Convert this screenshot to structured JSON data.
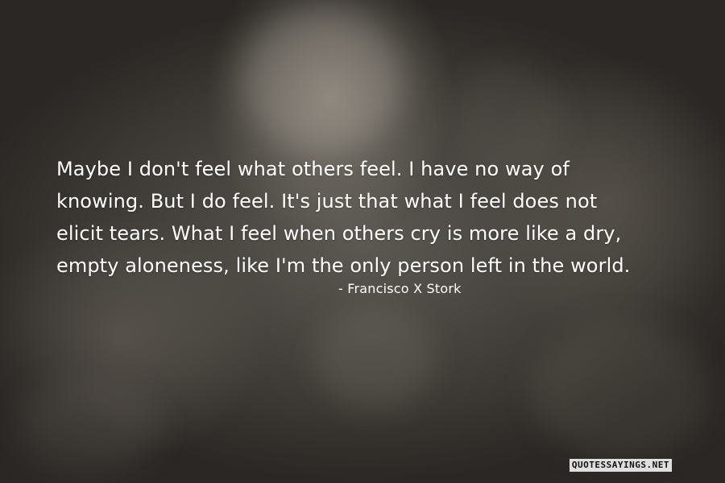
{
  "quote": {
    "lines": [
      "Maybe I don't feel what others feel. I have no way of",
      "knowing. But I do feel. It's just that what I feel does not",
      "elicit tears. What I feel when others cry is more like a dry,",
      "empty aloneness, like I'm the only person left in the world."
    ],
    "author": "- Francisco X Stork"
  },
  "watermark": "QUOTESSAYINGS.NET"
}
